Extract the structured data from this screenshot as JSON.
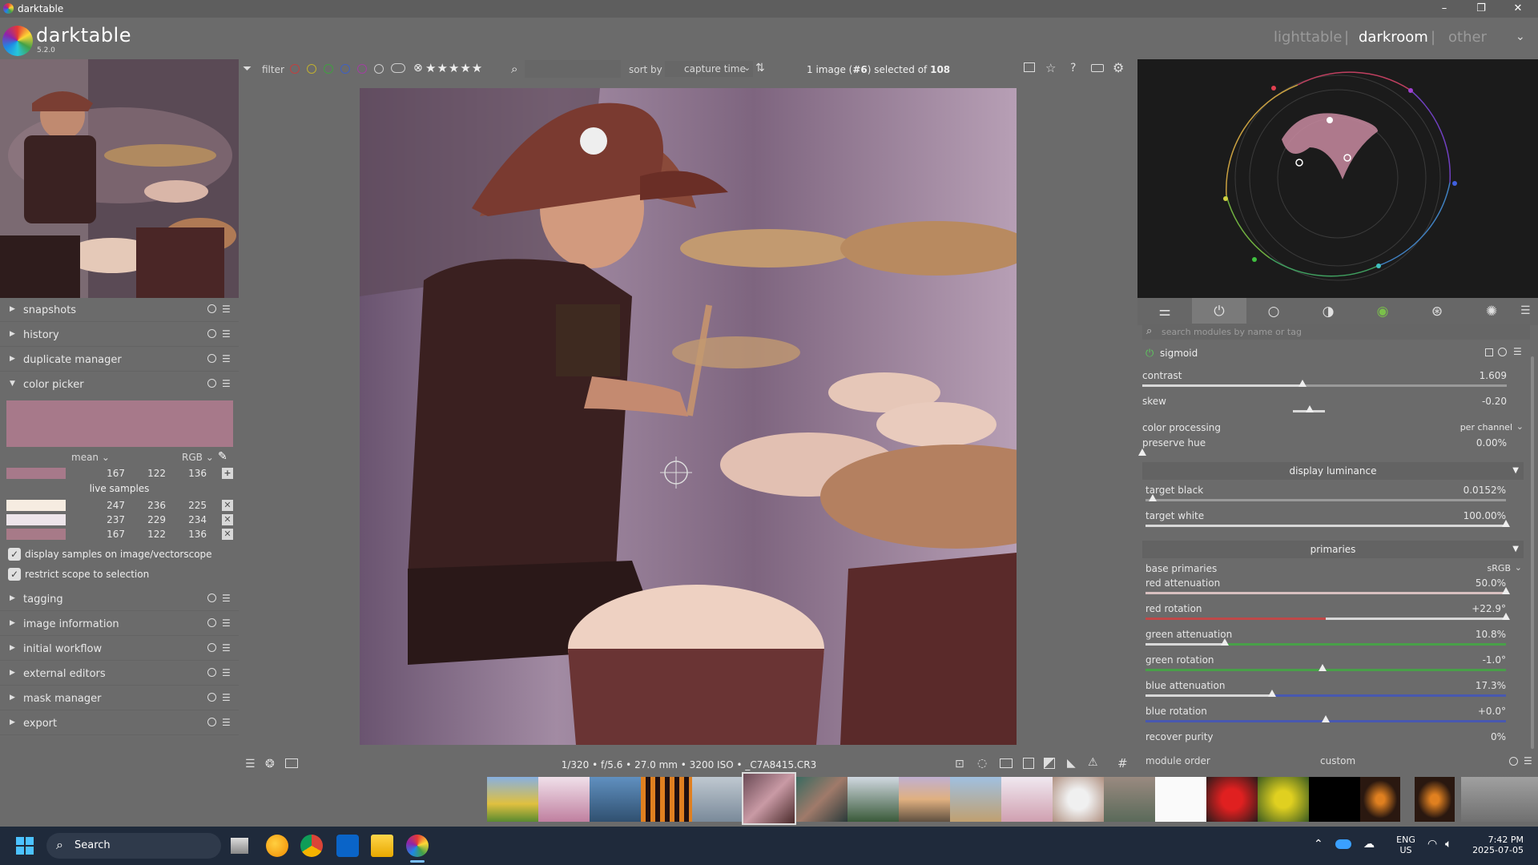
{
  "window": {
    "title": "darktable",
    "minimize": "–",
    "maximize": "❐",
    "close": "✕"
  },
  "app": {
    "name": "darktable",
    "version": "5.2.0"
  },
  "views": {
    "lighttable": "lighttable",
    "sep1": "|",
    "darkroom": "darkroom",
    "sep2": "|",
    "other": "other"
  },
  "colors": {
    "accent_pink": "#a7798a"
  },
  "topbar": {
    "filter_label": "filter",
    "sort_label": "sort by",
    "sort_value": "capture time",
    "count_prefix": "1 image (",
    "count_id": "#6",
    "count_suffix": ") selected of ",
    "count_total": "108",
    "rating_stars": "★★★★★"
  },
  "left_panel": {
    "items_top": [
      {
        "label": "snapshots"
      },
      {
        "label": "history"
      },
      {
        "label": "duplicate manager"
      },
      {
        "label": "color picker"
      }
    ],
    "color_picker": {
      "mode": "mean",
      "space": "RGB",
      "main_values": [
        "167",
        "122",
        "136"
      ],
      "live_samples_label": "live samples",
      "samples": [
        {
          "color": "#f6ece1",
          "values": [
            "247",
            "236",
            "225"
          ]
        },
        {
          "color": "#ede5ea",
          "values": [
            "237",
            "229",
            "234"
          ]
        },
        {
          "color": "#a77a88",
          "values": [
            "167",
            "122",
            "136"
          ]
        }
      ],
      "check1": "display samples on image/vectorscope",
      "check2": "restrict scope to selection"
    },
    "items_bottom": [
      {
        "label": "tagging"
      },
      {
        "label": "image information"
      },
      {
        "label": "initial workflow"
      },
      {
        "label": "external editors"
      },
      {
        "label": "mask manager"
      },
      {
        "label": "export"
      }
    ]
  },
  "statusbar": {
    "exif": "1/320 • f/5.6 • 27.0 mm • 3200 ISO • _C7A8415.CR3"
  },
  "right_panel": {
    "search_placeholder": "search modules by name or tag",
    "module_name": "sigmoid",
    "contrast": {
      "label": "contrast",
      "value": "1.609",
      "pct": 0.44
    },
    "skew": {
      "label": "skew",
      "value": "-0.20",
      "pct": 0.46
    },
    "color_processing": {
      "label": "color processing",
      "value": "per channel"
    },
    "preserve_hue": {
      "label": "preserve hue",
      "value": "0.00%",
      "pct": 0.0
    },
    "section_display": "display luminance",
    "target_black": {
      "label": "target black",
      "value": "0.0152%",
      "pct": 0.02
    },
    "target_white": {
      "label": "target white",
      "value": "100.00%",
      "pct": 1.0
    },
    "section_primaries": "primaries",
    "base_primaries": {
      "label": "base primaries",
      "value": "sRGB"
    },
    "red_attenuation": {
      "label": "red attenuation",
      "value": "50.0%",
      "pct": 1.0
    },
    "red_rotation": {
      "label": "red rotation",
      "value": "+22.9°",
      "pct": 1.0
    },
    "green_attenuation": {
      "label": "green attenuation",
      "value": "10.8%",
      "pct": 0.22
    },
    "green_rotation": {
      "label": "green rotation",
      "value": "-1.0°",
      "pct": 0.49
    },
    "blue_attenuation": {
      "label": "blue attenuation",
      "value": "17.3%",
      "pct": 0.35
    },
    "blue_rotation": {
      "label": "blue rotation",
      "value": "+0.0°",
      "pct": 0.5
    },
    "recover_purity": {
      "label": "recover purity",
      "value": "0%"
    },
    "module_order_label": "module order",
    "module_order_value": "custom"
  },
  "taskbar": {
    "search": "Search",
    "lang": "ENG",
    "region": "US",
    "time": "7:42 PM",
    "date": "2025-07-05"
  }
}
